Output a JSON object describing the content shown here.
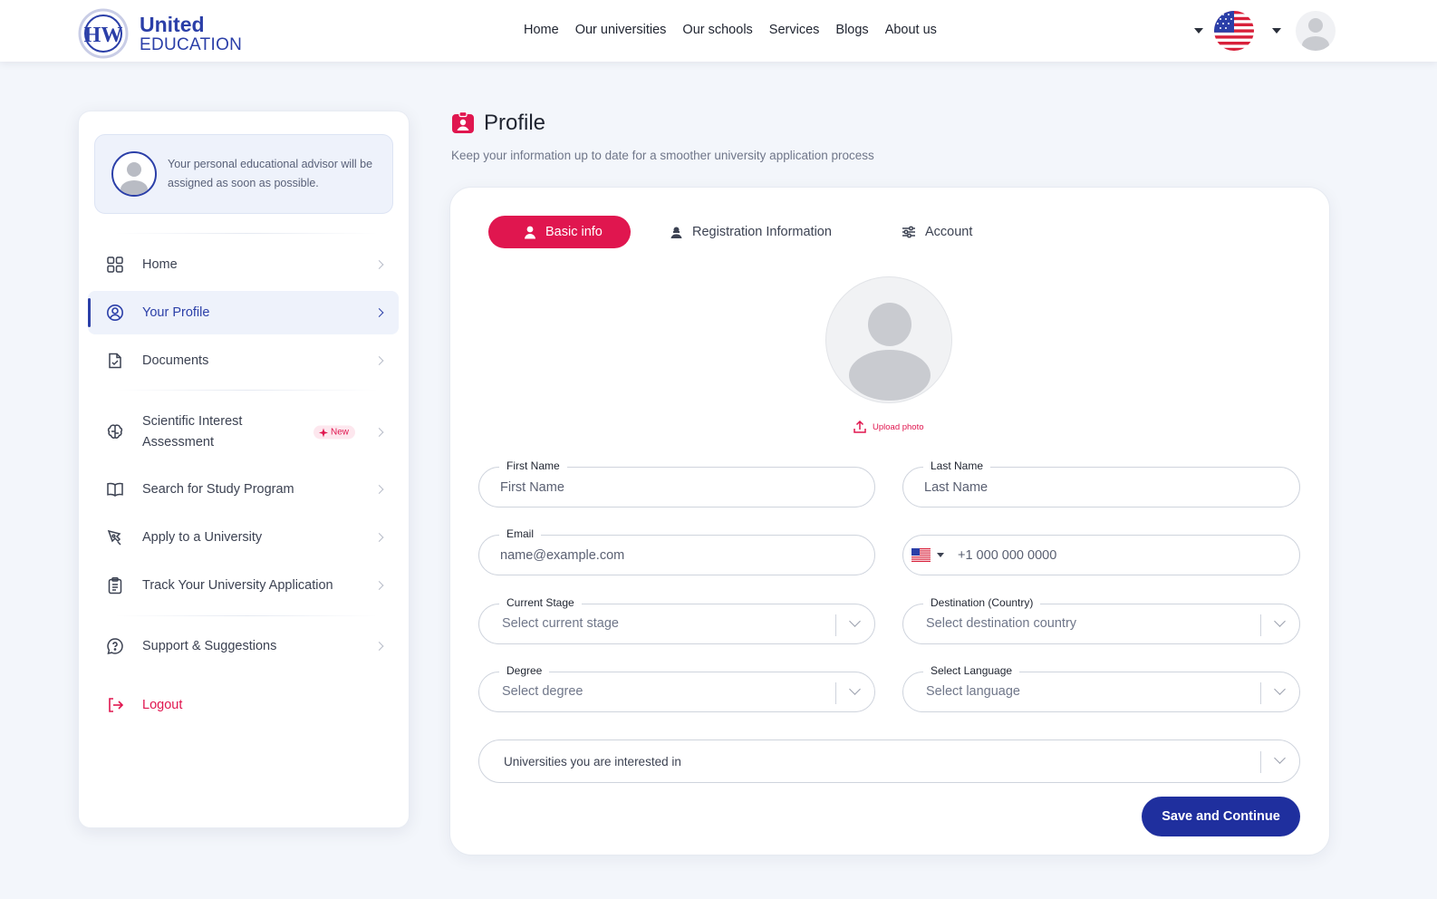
{
  "brand": {
    "line1": "United",
    "line2": "EDUCATION",
    "mark": "HW"
  },
  "nav": {
    "items": [
      "Home",
      "Our universities",
      "Our schools",
      "Services",
      "Blogs",
      "About us"
    ]
  },
  "sidebar": {
    "advisor_text": "Your personal educational advisor will be assigned as soon as possible.",
    "items": [
      {
        "label": "Home",
        "icon": "grid-icon"
      },
      {
        "label": "Your Profile",
        "icon": "user-circle-icon"
      },
      {
        "label": "Documents",
        "icon": "document-check-icon"
      },
      {
        "label": "Scientific Interest Assessment",
        "icon": "brain-icon",
        "badge": "New"
      },
      {
        "label": "Search for Study Program",
        "icon": "book-icon"
      },
      {
        "label": "Apply to a University",
        "icon": "pen-tool-icon"
      },
      {
        "label": "Track Your University Application",
        "icon": "clipboard-icon"
      },
      {
        "label": "Support & Suggestions",
        "icon": "help-chat-icon"
      },
      {
        "label": "Logout",
        "icon": "logout-icon"
      }
    ]
  },
  "page": {
    "title": "Profile",
    "subtitle": "Keep your information up to date for a smoother university application process"
  },
  "tabs": [
    {
      "label": "Basic info",
      "active": true
    },
    {
      "label": "Registration Information",
      "active": false
    },
    {
      "label": "Account",
      "active": false
    }
  ],
  "photo": {
    "upload_label": "Upload photo"
  },
  "form": {
    "first_name": {
      "label": "First Name",
      "placeholder": "First Name"
    },
    "last_name": {
      "label": "Last Name",
      "placeholder": "Last Name"
    },
    "email": {
      "label": "Email",
      "placeholder": "name@example.com"
    },
    "phone": {
      "placeholder": "+1 000 000 0000"
    },
    "current_stage": {
      "label": "Current Stage",
      "placeholder": "Select current stage"
    },
    "destination": {
      "label": "Destination (Country)",
      "placeholder": "Select destination country"
    },
    "degree": {
      "label": "Degree",
      "placeholder": "Select degree"
    },
    "language": {
      "label": "Select Language",
      "placeholder": "Select language"
    },
    "universities": {
      "placeholder": "Universities you are interested in"
    },
    "submit_label": "Save and Continue"
  },
  "colors": {
    "primary": "#2b3fa8",
    "accent": "#e0164f",
    "button": "#1f2f9e"
  }
}
